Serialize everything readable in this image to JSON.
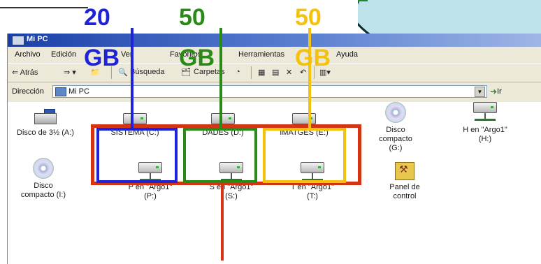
{
  "colors": {
    "blue": "#1f23d8",
    "green": "#2a8a17",
    "yellow": "#f4c20c",
    "red": "#d23414"
  },
  "annotations": {
    "c": {
      "size": "20",
      "unit": "GB"
    },
    "d": {
      "size": "50",
      "unit": "GB"
    },
    "e": {
      "size": "50",
      "unit": "GB"
    }
  },
  "window": {
    "title": "Mi PC",
    "menu": [
      "Archivo",
      "Edición",
      "Ver",
      "Favoritos",
      "Herramientas",
      "Ayuda"
    ],
    "toolbar": {
      "back": "⇐ Atrás",
      "search": "Búsqueda",
      "folders": "Carpetas"
    },
    "address_label": "Dirección",
    "address_value": "Mi PC",
    "go": "Ir"
  },
  "items": [
    {
      "name": "Disco de 3½ (A:)",
      "icon": "floppy-icon"
    },
    {
      "name": "SISTEMA (C:)",
      "icon": "drive-icon"
    },
    {
      "name": "DADES (D:)",
      "icon": "drive-icon"
    },
    {
      "name": "IMATGES (E:)",
      "icon": "drive-icon"
    },
    {
      "name": "Disco compacto (G:)",
      "icon": "cd-icon"
    },
    {
      "name": "H en \"Argo1\" (H:)",
      "icon": "network-drive-icon"
    },
    {
      "name": "Disco compacto (I:)",
      "icon": "cd-icon"
    },
    {
      "name": "P en \"Argo1\" (P:)",
      "icon": "network-drive-icon"
    },
    {
      "name": "S en \"Argo1\" (S:)",
      "icon": "network-drive-icon"
    },
    {
      "name": "T en \"Argo1\" (T:)",
      "icon": "network-drive-icon"
    },
    {
      "name": "Panel de control",
      "icon": "control-panel-icon"
    }
  ]
}
